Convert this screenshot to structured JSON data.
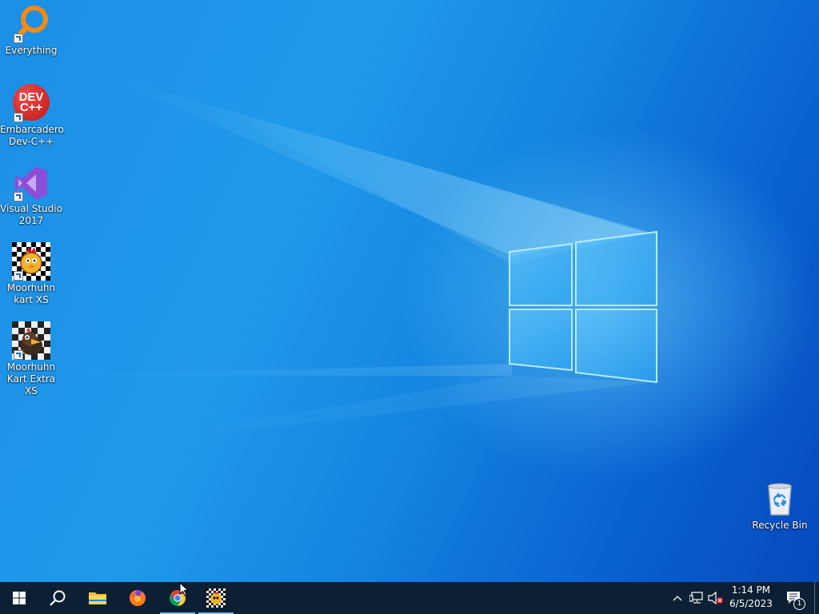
{
  "desktop": {
    "icons": [
      {
        "label": "Everything",
        "icon": "everything-search-icon"
      },
      {
        "label": "Embarcadero\nDev-C++",
        "icon": "devcpp-icon"
      },
      {
        "label": "Visual Studio\n2017",
        "icon": "visual-studio-icon"
      },
      {
        "label": "Moorhuhn\nkart XS",
        "icon": "moorhuhn-kart-icon"
      },
      {
        "label": "Moorhuhn\nKart Extra XS",
        "icon": "moorhuhn-kart-extra-icon"
      },
      {
        "label": "Recycle Bin",
        "icon": "recycle-bin-icon"
      }
    ],
    "devcpp_logo_text": "DEV\nC++"
  },
  "taskbar": {
    "buttons": [
      "start-icon",
      "search-icon",
      "file-explorer-icon",
      "firefox-icon",
      "chrome-icon",
      "moorhuhn-kart-icon"
    ],
    "clock": {
      "time": "1:14 PM",
      "date": "6/5/2023"
    },
    "notification_count": "1"
  },
  "colors": {
    "taskbar": "#0d1f33",
    "accent": "#76b9ed",
    "desktop": "#1a8ee6"
  }
}
